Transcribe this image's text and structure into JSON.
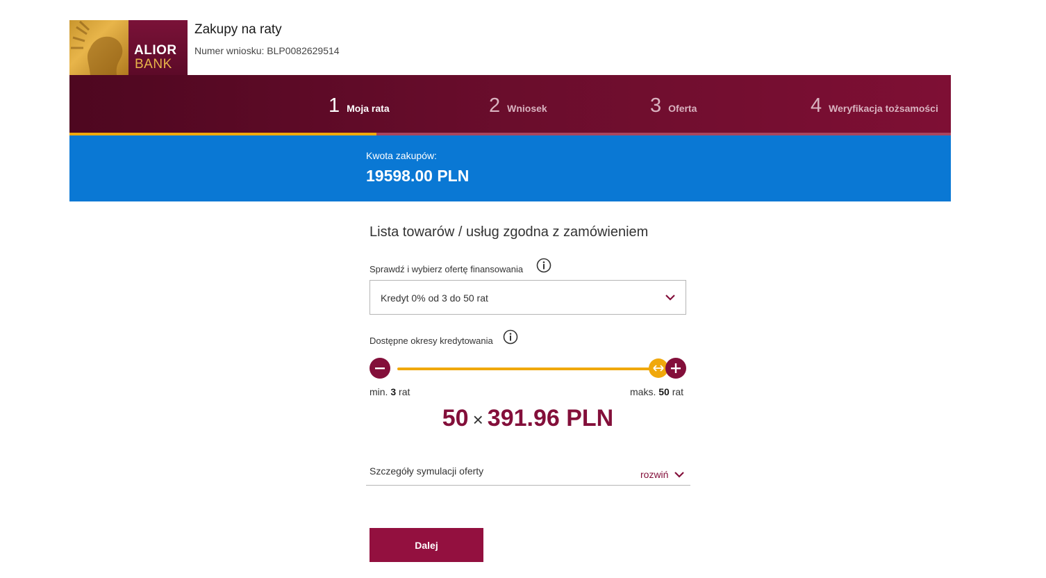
{
  "header": {
    "logo_line1": "ALIOR",
    "logo_line2": "BANK",
    "title": "Zakupy na raty",
    "application_number": "Numer wniosku: BLP0082629514"
  },
  "steps": [
    {
      "number": "1",
      "label": "Moja rata",
      "active": true
    },
    {
      "number": "2",
      "label": "Wniosek",
      "active": false
    },
    {
      "number": "3",
      "label": "Oferta",
      "active": false
    },
    {
      "number": "4",
      "label": "Weryfikacja tożsamości",
      "active": false
    }
  ],
  "progress": {
    "current_step": 1,
    "total_steps": 4
  },
  "amount": {
    "label": "Kwota zakupów:",
    "value": "19598.00 PLN"
  },
  "main": {
    "section_title": "Lista towarów / usług zgodna z zamówieniem",
    "offer_label": "Sprawdź i wybierz ofertę finansowania",
    "offer_selected": "Kredyt 0% od 3 do 50 rat",
    "period_label": "Dostępne okresy kredytowania",
    "slider": {
      "min_prefix": "min.",
      "min_value": "3",
      "min_suffix": "rat",
      "max_prefix": "maks.",
      "max_value": "50",
      "max_suffix": "rat",
      "current": 50
    },
    "installment": {
      "count": "50",
      "times": "×",
      "amount": "391.96 PLN"
    },
    "details_label": "Szczegóły symulacji oferty",
    "details_toggle": "rozwiń",
    "next_button": "Dalej"
  },
  "colors": {
    "brand": "#830f3a",
    "accent": "#f0a80c",
    "amount_bar": "#0a78d4"
  }
}
